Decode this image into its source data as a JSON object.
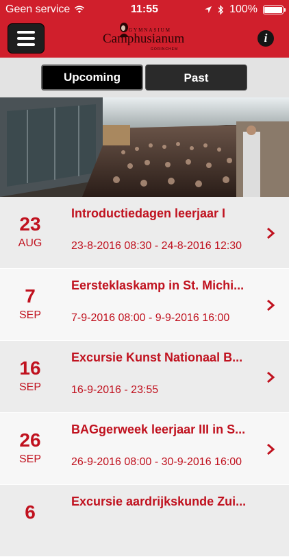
{
  "status": {
    "carrier": "Geen service",
    "time": "11:55",
    "battery_pct": "100%",
    "battery_level": 1.0
  },
  "header": {
    "logo_top": "GYMNASIUM",
    "logo_name": "Camphusianum",
    "logo_bottom": "GORINCHEM",
    "info_label": "i"
  },
  "tabs": [
    {
      "label": "Upcoming",
      "active": true
    },
    {
      "label": "Past",
      "active": false
    }
  ],
  "events": [
    {
      "day": "23",
      "month": "AUG",
      "title": "Introductiedagen leerjaar I",
      "dates": "23-8-2016 08:30 - 24-8-2016 12:30"
    },
    {
      "day": "7",
      "month": "SEP",
      "title": "Eersteklaskamp in St. Michi...",
      "dates": "7-9-2016 08:00 - 9-9-2016 16:00"
    },
    {
      "day": "16",
      "month": "SEP",
      "title": "Excursie Kunst Nationaal B...",
      "dates": "16-9-2016 - 23:55"
    },
    {
      "day": "26",
      "month": "SEP",
      "title": "BAGgerweek leerjaar III in S...",
      "dates": "26-9-2016 08:00 - 30-9-2016 16:00"
    },
    {
      "day": "6",
      "month": "",
      "title": "Excursie aardrijkskunde Zui...",
      "dates": ""
    }
  ],
  "colors": {
    "brand_red": "#d01f2c",
    "text_red": "#c0121f"
  }
}
